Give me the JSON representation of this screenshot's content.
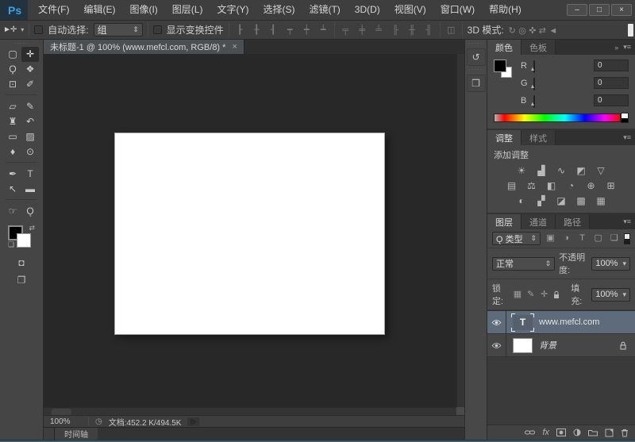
{
  "colors": {
    "accent_blue": "#3aa3e8",
    "selected_layer": "#5d6b7a",
    "canvas": "#ffffff",
    "ui": "#3e3e3e"
  },
  "window": {
    "logo": "Ps",
    "controls": [
      {
        "name": "minimize",
        "glyph": "–"
      },
      {
        "name": "maximize",
        "glyph": "□"
      },
      {
        "name": "close",
        "glyph": "×"
      }
    ]
  },
  "menubar": {
    "items": [
      "文件(F)",
      "编辑(E)",
      "图像(I)",
      "图层(L)",
      "文字(Y)",
      "选择(S)",
      "滤镜(T)",
      "3D(D)",
      "视图(V)",
      "窗口(W)",
      "帮助(H)"
    ]
  },
  "optionsbar": {
    "move_tool_glyph": "►✛",
    "dropdown_arrow": "▾",
    "auto_select_label": "自动选择:",
    "auto_select_value": "组",
    "show_transform_label": "显示变换控件",
    "align_icons": [
      {
        "name": "align-left-edges",
        "glyph": "┠"
      },
      {
        "name": "align-horizontal-centers",
        "glyph": "╂"
      },
      {
        "name": "align-right-edges",
        "glyph": "┨"
      },
      {
        "name": "align-top-edges",
        "glyph": "┯"
      },
      {
        "name": "align-vertical-centers",
        "glyph": "┿"
      },
      {
        "name": "align-bottom-edges",
        "glyph": "┷"
      }
    ],
    "distribute_icons": [
      {
        "name": "distribute-top-edges",
        "glyph": "╤"
      },
      {
        "name": "distribute-vertical-centers",
        "glyph": "╪"
      },
      {
        "name": "distribute-bottom-edges",
        "glyph": "╧"
      },
      {
        "name": "distribute-left-edges",
        "glyph": "╟"
      },
      {
        "name": "distribute-horizontal-centers",
        "glyph": "╫"
      },
      {
        "name": "distribute-right-edges",
        "glyph": "╢"
      }
    ],
    "auto_align_icon": {
      "name": "auto-align-layers",
      "glyph": "◫"
    },
    "mode_label": "3D 模式:",
    "mode_icons": [
      {
        "name": "3d-orbit",
        "glyph": "↻"
      },
      {
        "name": "3d-roll",
        "glyph": "◎"
      },
      {
        "name": "3d-pan",
        "glyph": "✜"
      },
      {
        "name": "3d-slide",
        "glyph": "⇄"
      },
      {
        "name": "3d-camera",
        "glyph": "◄"
      }
    ]
  },
  "tools": [
    {
      "name": "rect-marquee",
      "glyph": "▢"
    },
    {
      "name": "move",
      "glyph": "✛"
    },
    {
      "name": "lasso",
      "glyph": "Ϙ"
    },
    {
      "name": "quick-select",
      "glyph": "❖"
    },
    {
      "name": "crop",
      "glyph": "⊡"
    },
    {
      "name": "eyedropper",
      "glyph": "✐"
    },
    {
      "name": "spot-healing",
      "glyph": "▱"
    },
    {
      "name": "brush",
      "glyph": "✎"
    },
    {
      "name": "clone-stamp",
      "glyph": "♜"
    },
    {
      "name": "history-brush",
      "glyph": "↶"
    },
    {
      "name": "eraser",
      "glyph": "▭"
    },
    {
      "name": "gradient",
      "glyph": "▨"
    },
    {
      "name": "blur",
      "glyph": "♦"
    },
    {
      "name": "dodge",
      "glyph": "⊙"
    },
    {
      "name": "pen",
      "glyph": "✒"
    },
    {
      "name": "type",
      "glyph": "T"
    },
    {
      "name": "path-select",
      "glyph": "↖"
    },
    {
      "name": "shape",
      "glyph": "▬"
    },
    {
      "name": "hand",
      "glyph": "☞"
    },
    {
      "name": "zoom",
      "glyph": "Ǫ"
    }
  ],
  "toolbar_extras": {
    "swap_glyph": "⇄",
    "default_glyph": "❏",
    "quick_mask_glyph": "◘",
    "screen_mode_glyph": "❐",
    "grip": "·····"
  },
  "doc": {
    "tab_title": "未标题-1 @ 100% (www.mefcl.com, RGB/8) *",
    "close_glyph": "×",
    "status_zoom": "100%",
    "status_icon": "◷",
    "status_doc": "文档:452.2 K/494.5K",
    "status_arrow": "▶",
    "timeline_label": "时间轴"
  },
  "minidock": [
    {
      "name": "history-panel",
      "glyph": "↺"
    },
    {
      "name": "3d-panel",
      "glyph": "❒"
    }
  ],
  "color_panel": {
    "tab_active": "颜色",
    "tab_inactive": "色板",
    "collapse_glyph": "»",
    "menu_glyph": "▾≡",
    "thumb_glyph": "▴",
    "channels": [
      {
        "label": "R",
        "value": "0"
      },
      {
        "label": "G",
        "value": "0"
      },
      {
        "label": "B",
        "value": "0"
      }
    ]
  },
  "adjustments": {
    "tab_active": "调整",
    "tab_inactive": "样式",
    "menu_glyph": "▾≡",
    "add_label": "添加调整",
    "row1": [
      {
        "name": "brightness-contrast",
        "glyph": "☀"
      },
      {
        "name": "levels",
        "glyph": "▟"
      },
      {
        "name": "curves",
        "glyph": "∿"
      },
      {
        "name": "exposure",
        "glyph": "◩"
      },
      {
        "name": "vibrance",
        "glyph": "▽"
      }
    ],
    "row2": [
      {
        "name": "hue-saturation",
        "glyph": "▤"
      },
      {
        "name": "color-balance",
        "glyph": "⚖"
      },
      {
        "name": "black-white",
        "glyph": "◧"
      },
      {
        "name": "photo-filter",
        "glyph": "◔"
      },
      {
        "name": "channel-mixer",
        "glyph": "⊕"
      },
      {
        "name": "color-lookup",
        "glyph": "⊞"
      }
    ],
    "row3": [
      {
        "name": "invert",
        "glyph": "◐"
      },
      {
        "name": "posterize",
        "glyph": "▞"
      },
      {
        "name": "threshold",
        "glyph": "◪"
      },
      {
        "name": "gradient-map",
        "glyph": "▩"
      },
      {
        "name": "selective-color",
        "glyph": "▦"
      }
    ]
  },
  "layers": {
    "tab_layers": "图层",
    "tab_channels": "通道",
    "tab_paths": "路径",
    "menu_glyph": "▾≡",
    "search_glyph": "Ǫ",
    "filter_type_label": "类型",
    "combo_arrows": "⇕",
    "dropdown_arrow": "▾",
    "filter_icons": [
      {
        "name": "filter-pixel-layers",
        "glyph": "▣"
      },
      {
        "name": "filter-adjustment-layers",
        "glyph": "◑"
      },
      {
        "name": "filter-type-layers",
        "glyph": "T"
      },
      {
        "name": "filter-shape-layers",
        "glyph": "▢"
      },
      {
        "name": "filter-smart-objects",
        "glyph": "❏"
      }
    ],
    "blend_mode": "正常",
    "opacity_label": "不透明度:",
    "opacity_value": "100%",
    "lock_label": "锁定:",
    "lock_icons": [
      {
        "name": "lock-transparent-pixels",
        "glyph": "▦"
      },
      {
        "name": "lock-image-pixels",
        "glyph": "✎"
      },
      {
        "name": "lock-position",
        "glyph": "✛"
      }
    ],
    "fill_label": "填充:",
    "fill_value": "100%",
    "rows": [
      {
        "label": "www.mefcl.com",
        "type": "text",
        "selected": true
      },
      {
        "label": "背景",
        "type": "background",
        "locked": true
      }
    ],
    "thumb_t": "T",
    "fx_label": "fx"
  }
}
